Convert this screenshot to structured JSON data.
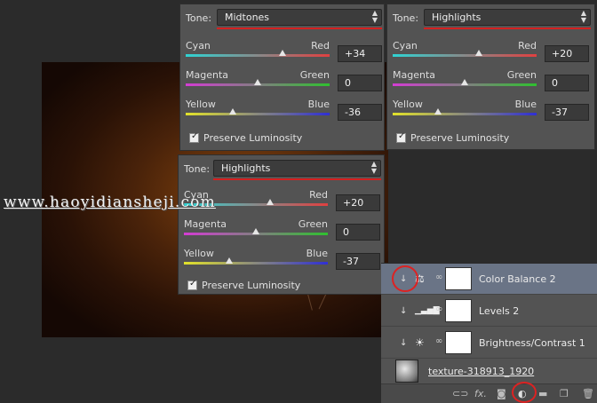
{
  "watermark": "www.haoyidiansheji.com",
  "panels": {
    "a": {
      "tone_label": "Tone:",
      "tone_value": "Midtones",
      "sliders": [
        {
          "left": "Cyan",
          "right": "Red",
          "value": "+34"
        },
        {
          "left": "Magenta",
          "right": "Green",
          "value": "0"
        },
        {
          "left": "Yellow",
          "right": "Blue",
          "value": "-36"
        }
      ],
      "preserve": "Preserve Luminosity"
    },
    "b": {
      "tone_label": "Tone:",
      "tone_value": "Highlights",
      "sliders": [
        {
          "left": "Cyan",
          "right": "Red",
          "value": "+20"
        },
        {
          "left": "Magenta",
          "right": "Green",
          "value": "0"
        },
        {
          "left": "Yellow",
          "right": "Blue",
          "value": "-37"
        }
      ],
      "preserve": "Preserve Luminosity"
    },
    "c": {
      "tone_label": "Tone:",
      "tone_value": "Highlights",
      "sliders": [
        {
          "left": "Cyan",
          "right": "Red",
          "value": "+20"
        },
        {
          "left": "Magenta",
          "right": "Green",
          "value": "0"
        },
        {
          "left": "Yellow",
          "right": "Blue",
          "value": "-37"
        }
      ],
      "preserve": "Preserve Luminosity"
    }
  },
  "layers": [
    {
      "name": "Color Balance 2",
      "selected": true,
      "icon": "color-balance-icon"
    },
    {
      "name": "Levels 2",
      "selected": false,
      "icon": "levels-icon"
    },
    {
      "name": "Brightness/Contrast 1",
      "selected": false,
      "icon": "brightness-contrast-icon"
    },
    {
      "name": "texture-318913_1920",
      "selected": false,
      "icon": "texture-thumbnail"
    }
  ],
  "footer_icons": [
    "link-icon",
    "fx-icon",
    "mask-icon",
    "adjustment-icon",
    "folder-icon",
    "new-layer-icon",
    "trash-icon"
  ],
  "footer_fx_label": "fx.",
  "colors": {
    "highlight_red": "#d42020",
    "selected_layer": "#6a7486",
    "panel_bg": "#535353"
  }
}
